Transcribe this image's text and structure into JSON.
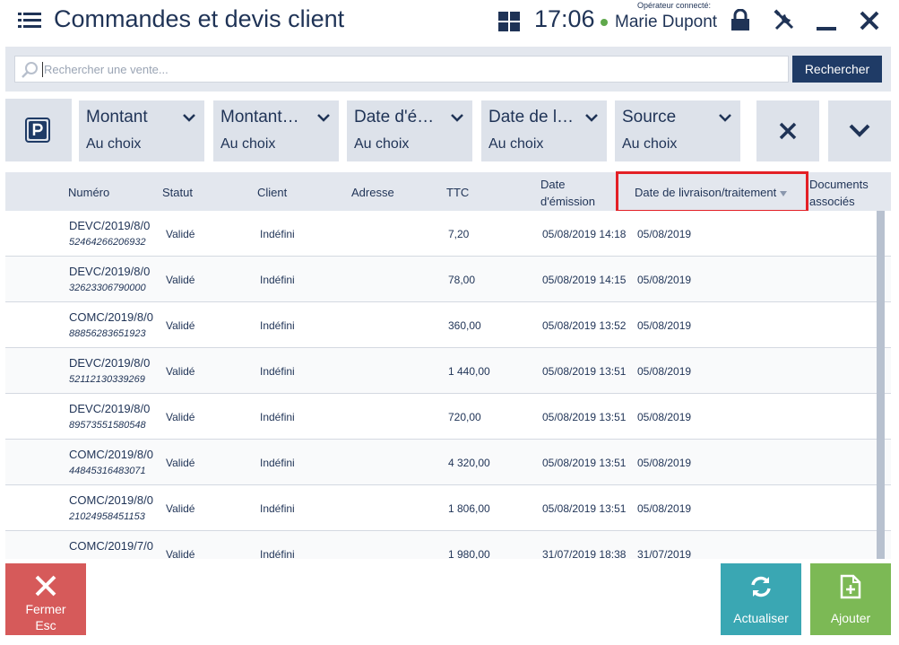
{
  "header": {
    "title": "Commandes et devis client",
    "clock": "17:06",
    "operator_label": "Opérateur connecté:",
    "operator_name": "Marie Dupont"
  },
  "search": {
    "placeholder": "Rechercher une vente...",
    "button_label": "Rechercher"
  },
  "filters": [
    {
      "title": "Montant",
      "value": "Au choix"
    },
    {
      "title": "Montant…",
      "value": "Au choix"
    },
    {
      "title": "Date d'é…",
      "value": "Au choix"
    },
    {
      "title": "Date de l…",
      "value": "Au choix"
    },
    {
      "title": "Source",
      "value": "Au choix"
    }
  ],
  "table": {
    "columns": {
      "numero": "Numéro",
      "statut": "Statut",
      "client": "Client",
      "adresse": "Adresse",
      "ttc": "TTC",
      "date_emission_l1": "Date",
      "date_emission_l2": "d'émission",
      "date_livraison": "Date de livraison/traitement",
      "documents_l1": "Documents",
      "documents_l2": "associés"
    },
    "rows": [
      {
        "numero": "DEVC/2019/8/0",
        "code": "52464266206932",
        "statut": "Validé",
        "client": "Indéfini",
        "ttc": "7,20",
        "emission": "05/08/2019 14:18",
        "livraison": "05/08/2019"
      },
      {
        "numero": "DEVC/2019/8/0",
        "code": "32623306790000",
        "statut": "Validé",
        "client": "Indéfini",
        "ttc": "78,00",
        "emission": "05/08/2019 14:15",
        "livraison": "05/08/2019"
      },
      {
        "numero": "COMC/2019/8/0",
        "code": "88856283651923",
        "statut": "Validé",
        "client": "Indéfini",
        "ttc": "360,00",
        "emission": "05/08/2019 13:52",
        "livraison": "05/08/2019"
      },
      {
        "numero": "DEVC/2019/8/0",
        "code": "52112130339269",
        "statut": "Validé",
        "client": "Indéfini",
        "ttc": "1 440,00",
        "emission": "05/08/2019 13:51",
        "livraison": "05/08/2019"
      },
      {
        "numero": "DEVC/2019/8/0",
        "code": "89573551580548",
        "statut": "Validé",
        "client": "Indéfini",
        "ttc": "720,00",
        "emission": "05/08/2019 13:51",
        "livraison": "05/08/2019"
      },
      {
        "numero": "COMC/2019/8/0",
        "code": "44845316483071",
        "statut": "Validé",
        "client": "Indéfini",
        "ttc": "4 320,00",
        "emission": "05/08/2019 13:51",
        "livraison": "05/08/2019"
      },
      {
        "numero": "COMC/2019/8/0",
        "code": "21024958451153",
        "statut": "Validé",
        "client": "Indéfini",
        "ttc": "1 806,00",
        "emission": "05/08/2019 13:51",
        "livraison": "05/08/2019"
      },
      {
        "numero": "COMC/2019/7/0",
        "code": "",
        "statut": "Validé",
        "client": "Indéfini",
        "ttc": "1 980,00",
        "emission": "31/07/2019 18:38",
        "livraison": "31/07/2019"
      }
    ]
  },
  "buttons": {
    "close_l1": "Fermer",
    "close_l2": "Esc",
    "refresh": "Actualiser",
    "add": "Ajouter"
  },
  "colors": {
    "primary": "#1f3b66",
    "close": "#d65a5a",
    "refresh": "#3aa7b3",
    "add": "#7cb955",
    "highlight": "#e32026"
  }
}
